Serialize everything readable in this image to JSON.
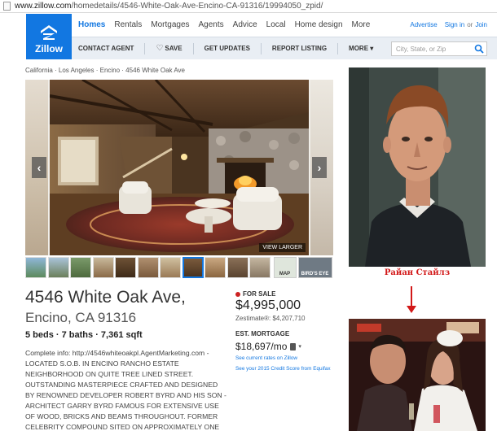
{
  "browser": {
    "url_host": "www.zillow.com",
    "url_path": "/homedetails/4546-White-Oak-Ave-Encino-CA-91316/19994050_zpid/"
  },
  "brand": {
    "logo_text": "Zillow",
    "color": "#1277e1"
  },
  "nav": {
    "items": [
      {
        "label": "Homes",
        "active": true
      },
      {
        "label": "Rentals"
      },
      {
        "label": "Mortgages"
      },
      {
        "label": "Agents"
      },
      {
        "label": "Advice"
      },
      {
        "label": "Local"
      },
      {
        "label": "Home design"
      },
      {
        "label": "More"
      }
    ],
    "advertise": "Advertise",
    "signin": "Sign in",
    "or": "or",
    "join": "Join"
  },
  "subnav": {
    "contact": "CONTACT AGENT",
    "save": "SAVE",
    "updates": "GET UPDATES",
    "report": "REPORT LISTING",
    "more": "MORE ▾",
    "search_placeholder": "City, State, or Zip"
  },
  "breadcrumb": "California · Los Angeles · Encino · 4546 White Oak Ave",
  "gallery": {
    "view_larger": "VIEW LARGER",
    "map_label": "MAP",
    "birds_eye_label": "BIRD'S EYE"
  },
  "listing": {
    "address": "4546 White Oak Ave,",
    "city_state": "Encino, CA 91316",
    "facts": "5 beds · 7 baths · 7,361 sqft",
    "description": "Complete info: http://4546whiteoakpl.AgentMarketing.com - LOCATED S.O.B. IN ENCINO RANCHO ESTATE NEIGHBORHOOD ON QUITE TREE LINED STREET. OUTSTANDING MASTERPIECE CRAFTED AND DESIGNED BY RENOWNED DEVELOPER ROBERT BYRD AND HIS SON - ARCHITECT GARRY BYRD FAMOUS FOR EXTENSIVE USE OF WOOD, BRICKS AND BEAMS THROUGHOUT. FORMER CELEBRITY COMPOUND SITED ON APPROXIMATELY ONE",
    "status": "FOR SALE",
    "price": "$4,995,000",
    "zestimate": "Zestimate®: $4,207,710",
    "mortgage_label": "EST. MORTGAGE",
    "mortgage": "$18,697/mo",
    "rate_link": "See current rates on Zillow",
    "credit_link": "See your 2015 Credit Score from Equifax"
  },
  "overlay": {
    "caption": "Райан Стайлз"
  }
}
